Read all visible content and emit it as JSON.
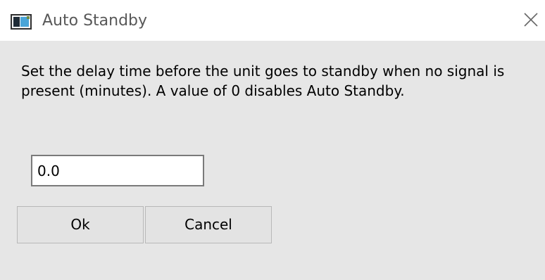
{
  "window": {
    "title": "Auto Standby",
    "app_icon": "monitor-app-icon",
    "close_icon": "close-icon"
  },
  "dialog": {
    "description": "Set the delay time before the unit goes to standby when no signal is present (minutes). A value of 0 disables Auto Standby.",
    "delay_value": "0.0",
    "ok_label": "Ok",
    "cancel_label": "Cancel"
  },
  "colors": {
    "titlebar_bg": "#ffffff",
    "client_bg": "#e6e6e6",
    "button_bg": "#e3e3e3",
    "button_border": "#b8b8b8",
    "input_border": "#7a7a7a"
  }
}
